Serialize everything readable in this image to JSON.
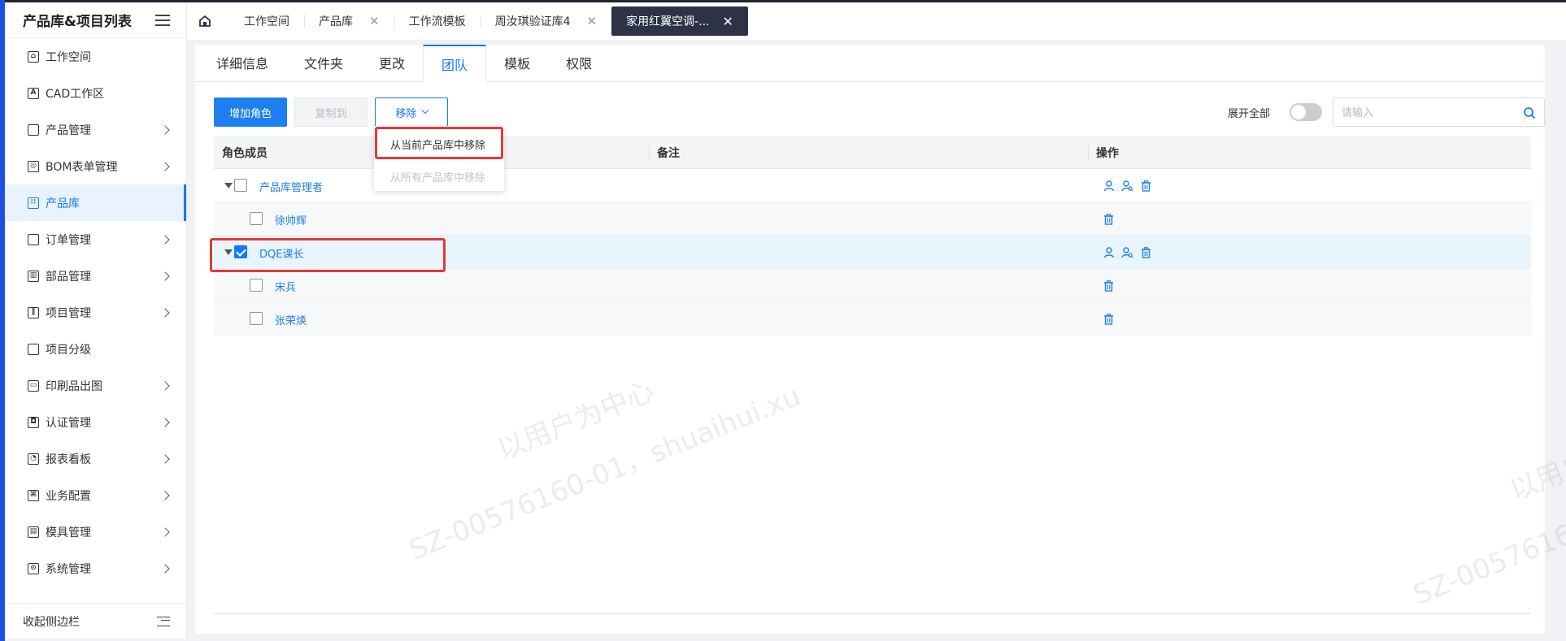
{
  "sidebar": {
    "title": "产品库&项目列表",
    "items": [
      {
        "label": "工作空间",
        "icon": "home-icon",
        "glyph": "⌂",
        "has_children": false,
        "active": false
      },
      {
        "label": "CAD工作区",
        "icon": "cad-icon",
        "glyph": "A",
        "has_children": false,
        "active": false
      },
      {
        "label": "产品管理",
        "icon": "box-icon",
        "glyph": "",
        "has_children": true,
        "active": false
      },
      {
        "label": "BOM表单管理",
        "icon": "bom-icon",
        "glyph": "◎",
        "has_children": true,
        "active": false
      },
      {
        "label": "产品库",
        "icon": "grid-icon",
        "glyph": "∷",
        "has_children": false,
        "active": true
      },
      {
        "label": "订单管理",
        "icon": "bag-icon",
        "glyph": "",
        "has_children": true,
        "active": false
      },
      {
        "label": "部品管理",
        "icon": "parts-icon",
        "glyph": "▥",
        "has_children": true,
        "active": false
      },
      {
        "label": "项目管理",
        "icon": "books-icon",
        "glyph": "∥",
        "has_children": true,
        "active": false
      },
      {
        "label": "项目分级",
        "icon": "copy-icon",
        "glyph": "",
        "has_children": false,
        "active": false
      },
      {
        "label": "印刷品出图",
        "icon": "printer-icon",
        "glyph": "▭",
        "has_children": true,
        "active": false
      },
      {
        "label": "认证管理",
        "icon": "scan-icon",
        "glyph": "◘",
        "has_children": true,
        "active": false
      },
      {
        "label": "报表看板",
        "icon": "pie-chart-icon",
        "glyph": "◔",
        "has_children": true,
        "active": false
      },
      {
        "label": "业务配置",
        "icon": "command-icon",
        "glyph": "⌘",
        "has_children": true,
        "active": false
      },
      {
        "label": "模具管理",
        "icon": "archive-icon",
        "glyph": "▤",
        "has_children": true,
        "active": false
      },
      {
        "label": "系统管理",
        "icon": "gear-icon",
        "glyph": "⊙",
        "has_children": true,
        "active": false
      }
    ],
    "collapse_label": "收起侧边栏"
  },
  "tabs": [
    {
      "label": "工作空间",
      "closable": false
    },
    {
      "label": "产品库",
      "closable": true
    },
    {
      "label": "工作流模板",
      "closable": false
    },
    {
      "label": "周汝琪验证库4",
      "closable": true
    },
    {
      "label": "家用红翼空调-...",
      "closable": true,
      "current": true
    }
  ],
  "subtabs": [
    {
      "label": "详细信息"
    },
    {
      "label": "文件夹"
    },
    {
      "label": "更改"
    },
    {
      "label": "团队",
      "active": true
    },
    {
      "label": "模板"
    },
    {
      "label": "权限"
    }
  ],
  "toolbar": {
    "add_role": "增加角色",
    "copy_to": "复制到",
    "remove": "移除",
    "expand_all": "展开全部",
    "search_placeholder": "请输入"
  },
  "dropdown": {
    "items": [
      {
        "label": "从当前产品库中移除",
        "enabled": true
      },
      {
        "label": "从所有产品库中移除",
        "enabled": false
      }
    ]
  },
  "table": {
    "headers": [
      "角色成员",
      "备注",
      "操作"
    ],
    "rows": [
      {
        "name": "产品库管理者",
        "level": 0,
        "expanded": true,
        "checked": false,
        "note": "",
        "actions": [
          "add-user-icon",
          "user-search-icon",
          "trash-icon"
        ]
      },
      {
        "name": "徐帅辉",
        "level": 1,
        "checked": false,
        "note": "",
        "actions": [
          "trash-icon"
        ]
      },
      {
        "name": "DQE课长",
        "level": 0,
        "expanded": true,
        "checked": true,
        "note": "",
        "actions": [
          "add-user-icon",
          "user-search-icon",
          "trash-icon"
        ]
      },
      {
        "name": "宋兵",
        "level": 1,
        "checked": false,
        "note": "",
        "actions": [
          "trash-icon"
        ]
      },
      {
        "name": "张荣焕",
        "level": 1,
        "checked": false,
        "note": "",
        "actions": [
          "trash-icon"
        ]
      }
    ]
  },
  "watermark": {
    "line1": "以用户为中心",
    "line2": "SZ-00576160-01，shuaihui.xu"
  },
  "colors": {
    "primary": "#1677ff",
    "button_blue": "#1e80f0",
    "current_tab_bg": "#2d3247",
    "highlight_red": "#e53935",
    "left_edge": "#1e50e6"
  }
}
